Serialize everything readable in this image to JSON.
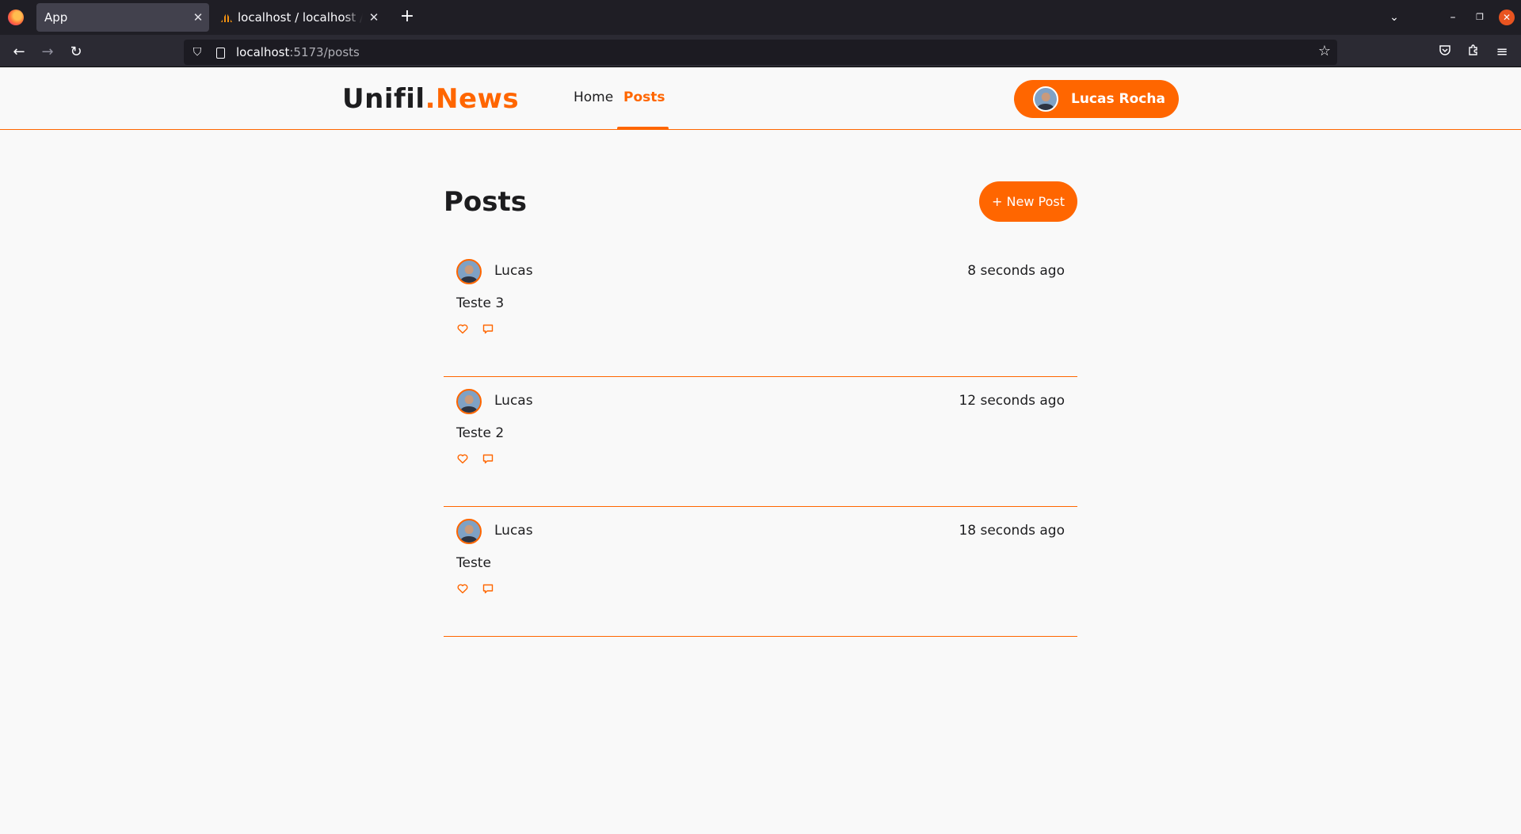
{
  "browser": {
    "tabs": [
      {
        "title": "App",
        "active": true
      },
      {
        "title": "localhost / localhost / crud",
        "active": false
      }
    ],
    "url": {
      "host": "localhost",
      "rest": ":5173/posts"
    }
  },
  "site": {
    "brand_main": "Unifil",
    "brand_accent": ".News",
    "nav": {
      "home": "Home",
      "posts": "Posts"
    },
    "user_name": "Lucas Rocha"
  },
  "main": {
    "title": "Posts",
    "new_post_label": "+ New Post",
    "posts": [
      {
        "author": "Lucas",
        "time": "8 seconds ago",
        "text": "Teste 3"
      },
      {
        "author": "Lucas",
        "time": "12 seconds ago",
        "text": "Teste 2"
      },
      {
        "author": "Lucas",
        "time": "18 seconds ago",
        "text": "Teste"
      }
    ]
  },
  "colors": {
    "accent": "#ff6600",
    "text": "#1d1d1f",
    "background": "#f9f9f9",
    "chrome_dark": "#1f1e25"
  },
  "icons": {
    "like": "heart-icon",
    "comment": "comment-icon"
  }
}
